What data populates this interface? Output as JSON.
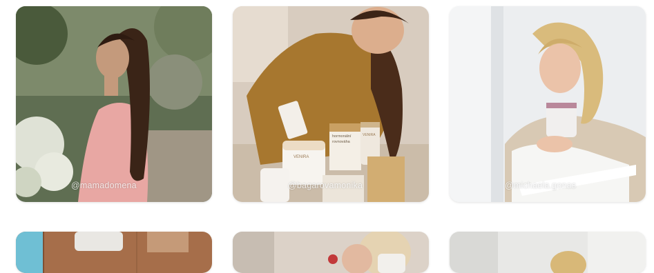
{
  "posts": [
    {
      "handle": "@mamadomena"
    },
    {
      "handle": "@bagarovamonika"
    },
    {
      "handle": "@michaela.gonas"
    }
  ],
  "products": {
    "jar_brand": "VENIRA",
    "box_line1": "hormonální",
    "box_line2": "rovnováha",
    "bottle_label": "VENIRA"
  },
  "colors": {
    "background": "#ffffff",
    "handle_text": "#ffffff"
  }
}
